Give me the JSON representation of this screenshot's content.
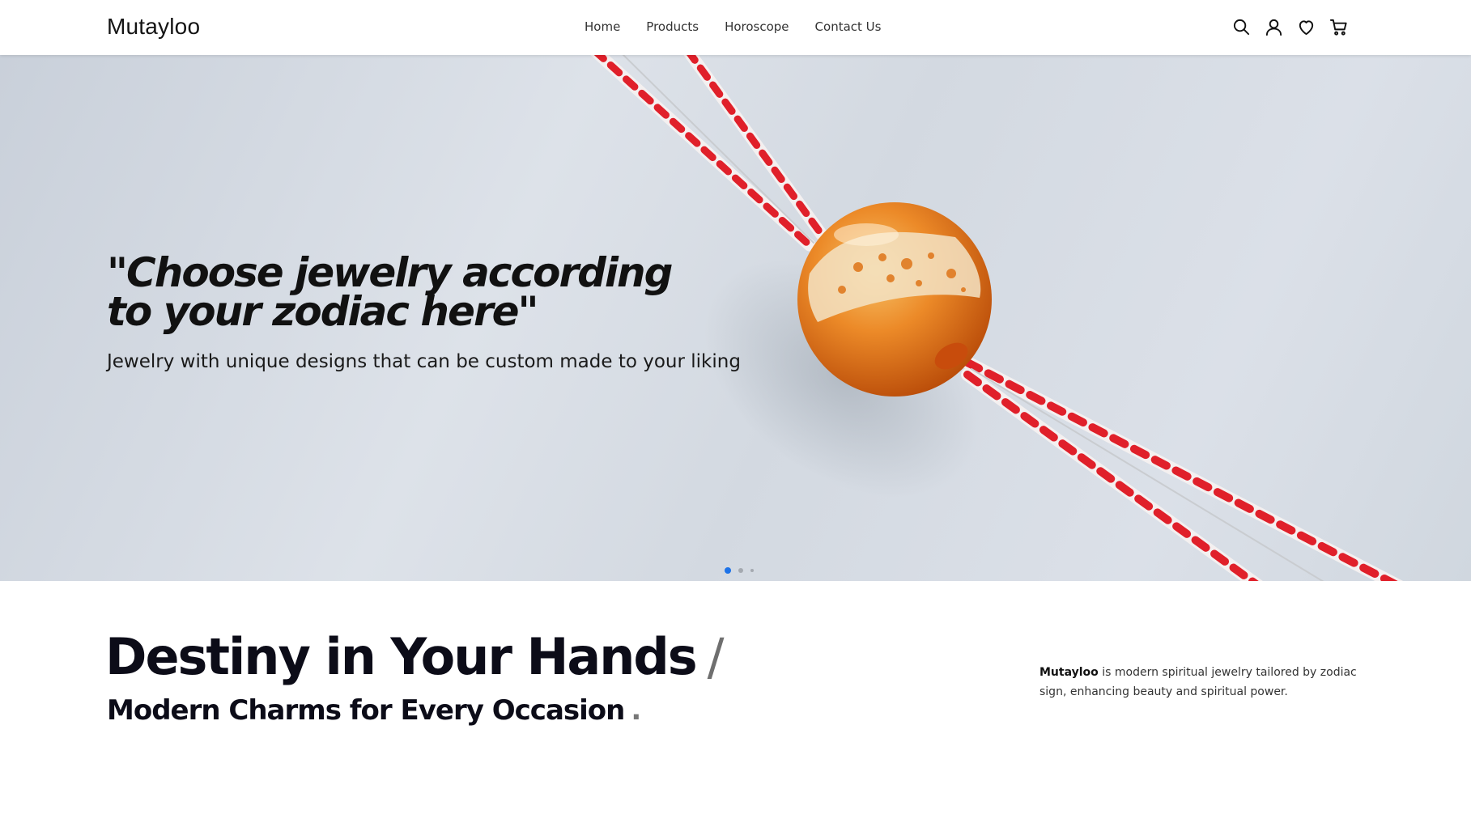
{
  "header": {
    "logo": "Mutayloo",
    "nav": [
      "Home",
      "Products",
      "Horoscope",
      "Contact Us"
    ],
    "icons": [
      "search-icon",
      "user-icon",
      "heart-icon",
      "cart-icon"
    ]
  },
  "hero": {
    "title": "\"Choose jewelry according to your zodiac here\"",
    "subtitle": "Jewelry with unique designs that can be custom made to your liking",
    "carousel": {
      "slide_count": 3,
      "active_index": 0
    }
  },
  "section": {
    "headline": "Destiny in Your Hands",
    "headline_mark": "/",
    "subheadline": "Modern Charms for Every Occasion",
    "subheadline_mark": ".",
    "about_brand": "Mutayloo",
    "about_text": " is modern spiritual jewelry tailored by zodiac sign, enhancing beauty and spiritual power."
  },
  "colors": {
    "accent": "#1e73e8",
    "text": "#111111",
    "cord_red": "#e0202a",
    "bead_orange": "#e06a10"
  }
}
